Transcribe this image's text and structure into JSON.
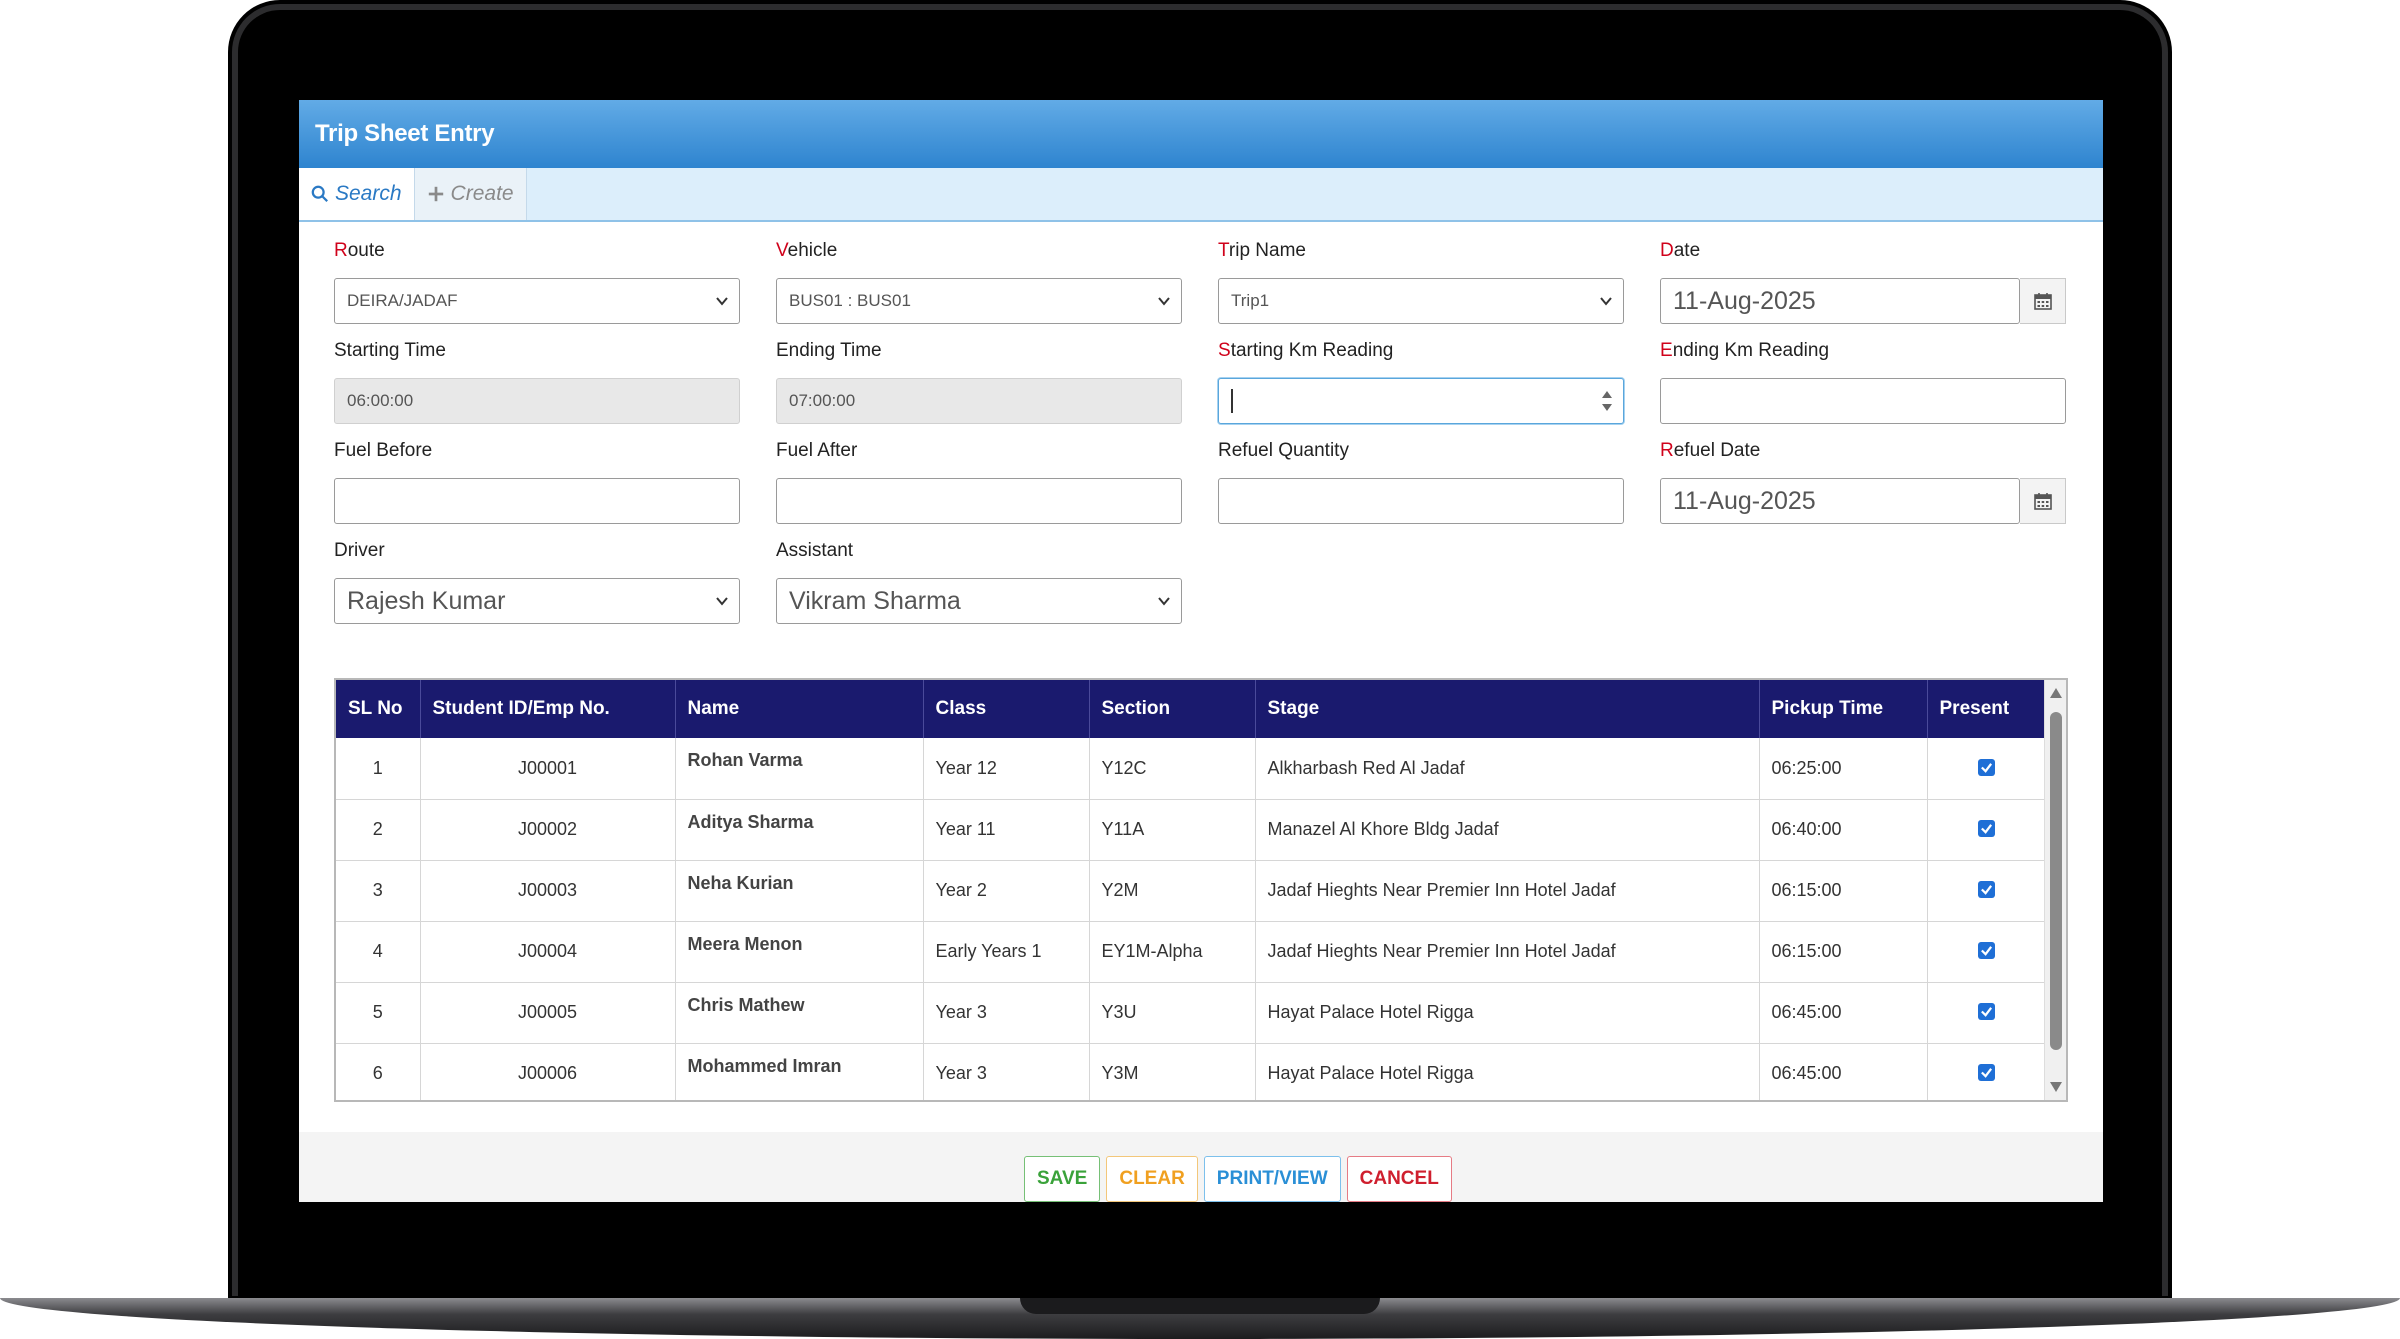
{
  "app": {
    "title": "Trip Sheet Entry"
  },
  "tabs": [
    {
      "label": "Search",
      "icon": "search-icon",
      "active": true
    },
    {
      "label": "Create",
      "icon": "plus-icon",
      "active": false
    }
  ],
  "form": {
    "route": {
      "label_first": "R",
      "label_rest": "oute",
      "value": "DEIRA/JADAF"
    },
    "vehicle": {
      "label_first": "V",
      "label_rest": "ehicle",
      "value": "BUS01 : BUS01"
    },
    "trip_name": {
      "label_first": "T",
      "label_rest": "rip Name",
      "value": "Trip1"
    },
    "date": {
      "label_first": "D",
      "label_rest": "ate",
      "value": "11-Aug-2025"
    },
    "starting_time": {
      "label": "Starting Time",
      "value": "06:00:00"
    },
    "ending_time": {
      "label": "Ending Time",
      "value": "07:00:00"
    },
    "starting_km": {
      "label_first": "S",
      "label_rest": "tarting Km Reading",
      "value": ""
    },
    "ending_km": {
      "label_first": "E",
      "label_rest": "nding Km Reading",
      "value": ""
    },
    "fuel_before": {
      "label": "Fuel Before",
      "value": ""
    },
    "fuel_after": {
      "label": "Fuel After",
      "value": ""
    },
    "refuel_quantity": {
      "label": "Refuel Quantity",
      "value": ""
    },
    "refuel_date": {
      "label_first": "R",
      "label_rest": "efuel Date",
      "value": "11-Aug-2025"
    },
    "driver": {
      "label": "Driver",
      "value": "Rajesh Kumar"
    },
    "assistant": {
      "label": "Assistant",
      "value": "Vikram Sharma"
    }
  },
  "table": {
    "headers": [
      "SL No",
      "Student ID/Emp No.",
      "Name",
      "Class",
      "Section",
      "Stage",
      "Pickup Time",
      "Present"
    ],
    "rows": [
      {
        "sl": "1",
        "id": "J00001",
        "name": "Rohan Varma",
        "class": "Year 12",
        "section": "Y12C",
        "stage": "Alkharbash Red Al Jadaf",
        "pickup": "06:25:00",
        "present": true
      },
      {
        "sl": "2",
        "id": "J00002",
        "name": "Aditya Sharma",
        "class": "Year 11",
        "section": "Y11A",
        "stage": "Manazel Al Khore Bldg Jadaf",
        "pickup": "06:40:00",
        "present": true
      },
      {
        "sl": "3",
        "id": "J00003",
        "name": "Neha Kurian",
        "class": "Year 2",
        "section": "Y2M",
        "stage": "Jadaf Hieghts Near Premier Inn Hotel Jadaf",
        "pickup": "06:15:00",
        "present": true
      },
      {
        "sl": "4",
        "id": "J00004",
        "name": "Meera Menon",
        "class": "Early Years 1",
        "section": "EY1M-Alpha",
        "stage": "Jadaf Hieghts Near Premier Inn Hotel Jadaf",
        "pickup": "06:15:00",
        "present": true
      },
      {
        "sl": "5",
        "id": "J00005",
        "name": "Chris Mathew",
        "class": "Year 3",
        "section": "Y3U",
        "stage": "Hayat Palace Hotel Rigga",
        "pickup": "06:45:00",
        "present": true
      },
      {
        "sl": "6",
        "id": "J00006",
        "name": "Mohammed Imran",
        "class": "Year 3",
        "section": "Y3M",
        "stage": "Hayat Palace Hotel Rigga",
        "pickup": "06:45:00",
        "present": true
      }
    ]
  },
  "actions": {
    "save": "SAVE",
    "clear": "CLEAR",
    "print": "PRINT/VIEW",
    "cancel": "CANCEL"
  },
  "colors": {
    "header_bg": "#1a1a6e",
    "title_bar": "#3a8fd8",
    "required": "#d0021b",
    "checkbox": "#1f6fd6"
  }
}
